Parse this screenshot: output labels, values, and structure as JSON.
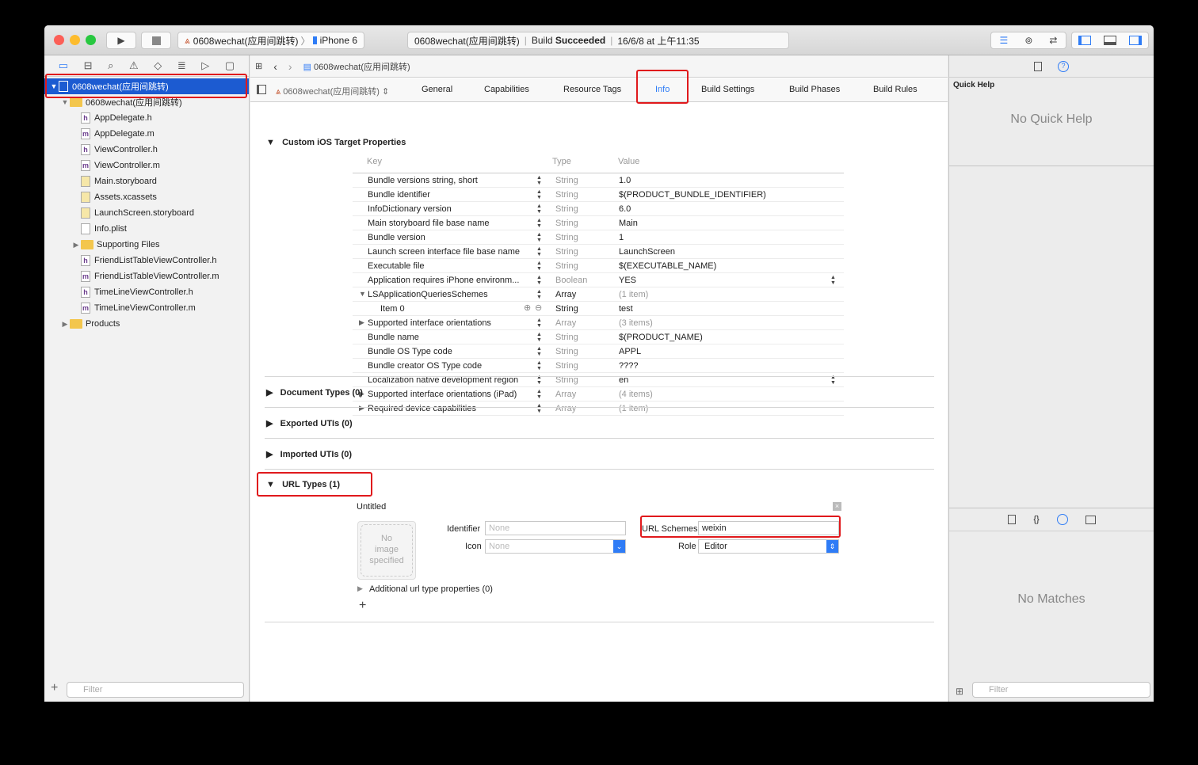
{
  "toolbar": {
    "scheme": "0608wechat(应用间跳转)",
    "device": "iPhone 6",
    "status_project": "0608wechat(应用间跳转)",
    "status_prefix": "Build ",
    "status_result": "Succeeded",
    "status_time": "16/6/8 at 上午11:35",
    "run_icon": "play-icon",
    "stop_icon": "stop-icon"
  },
  "navigator": {
    "icons": [
      "folder-icon",
      "hierarchy-icon",
      "search-icon",
      "warning-icon",
      "test-icon",
      "debug-icon",
      "breakpoint-icon",
      "report-icon"
    ],
    "items": [
      {
        "label": "0608wechat(应用间跳转)",
        "type": "project",
        "indent": 0,
        "disclosure": "open",
        "selected": true
      },
      {
        "label": "0608wechat(应用间跳转)",
        "type": "folder",
        "indent": 1,
        "disclosure": "open"
      },
      {
        "label": "AppDelegate.h",
        "type": "h",
        "indent": 2
      },
      {
        "label": "AppDelegate.m",
        "type": "m",
        "indent": 2
      },
      {
        "label": "ViewController.h",
        "type": "h",
        "indent": 2
      },
      {
        "label": "ViewController.m",
        "type": "m",
        "indent": 2
      },
      {
        "label": "Main.storyboard",
        "type": "storyboard",
        "indent": 2
      },
      {
        "label": "Assets.xcassets",
        "type": "assets",
        "indent": 2
      },
      {
        "label": "LaunchScreen.storyboard",
        "type": "storyboard",
        "indent": 2
      },
      {
        "label": "Info.plist",
        "type": "plist",
        "indent": 2
      },
      {
        "label": "Supporting Files",
        "type": "folder",
        "indent": 2,
        "disclosure": "closed"
      },
      {
        "label": "FriendListTableViewController.h",
        "type": "h",
        "indent": 2
      },
      {
        "label": "FriendListTableViewController.m",
        "type": "m",
        "indent": 2
      },
      {
        "label": "TimeLineViewController.h",
        "type": "h",
        "indent": 2
      },
      {
        "label": "TimeLineViewController.m",
        "type": "m",
        "indent": 2
      },
      {
        "label": "Products",
        "type": "folder",
        "indent": 1,
        "disclosure": "closed"
      }
    ],
    "filter_placeholder": "Filter",
    "add_label": "+"
  },
  "editor": {
    "breadcrumb": "0608wechat(应用间跳转)",
    "target": "0608wechat(应用间跳转)",
    "tabs": [
      "General",
      "Capabilities",
      "Resource Tags",
      "Info",
      "Build Settings",
      "Build Phases",
      "Build Rules"
    ],
    "active_tab": "Info",
    "custom_title": "Custom iOS Target Properties",
    "columns": {
      "key": "Key",
      "type": "Type",
      "value": "Value"
    },
    "properties": [
      {
        "key": "Bundle versions string, short",
        "type": "String",
        "value": "1.0"
      },
      {
        "key": "Bundle identifier",
        "type": "String",
        "value": "$(PRODUCT_BUNDLE_IDENTIFIER)"
      },
      {
        "key": "InfoDictionary version",
        "type": "String",
        "value": "6.0"
      },
      {
        "key": "Main storyboard file base name",
        "type": "String",
        "value": "Main"
      },
      {
        "key": "Bundle version",
        "type": "String",
        "value": "1"
      },
      {
        "key": "Launch screen interface file base name",
        "type": "String",
        "value": "LaunchScreen"
      },
      {
        "key": "Executable file",
        "type": "String",
        "value": "$(EXECUTABLE_NAME)"
      },
      {
        "key": "Application requires iPhone environm...",
        "type": "Boolean",
        "value": "YES",
        "popup": true
      },
      {
        "key": "LSApplicationQueriesSchemes",
        "type": "Array",
        "value": "(1 item)",
        "disclosure": "open",
        "dark_type": true
      },
      {
        "key": "Item 0",
        "type": "String",
        "value": "test",
        "child": true,
        "dark_type": true,
        "plusminus": true
      },
      {
        "key": "Supported interface orientations",
        "type": "Array",
        "value": "(3 items)",
        "disclosure": "closed"
      },
      {
        "key": "Bundle name",
        "type": "String",
        "value": "$(PRODUCT_NAME)"
      },
      {
        "key": "Bundle OS Type code",
        "type": "String",
        "value": "APPL"
      },
      {
        "key": "Bundle creator OS Type code",
        "type": "String",
        "value": "????"
      },
      {
        "key": "Localization native development region",
        "type": "String",
        "value": "en",
        "popup": true
      },
      {
        "key": "Supported interface orientations (iPad)",
        "type": "Array",
        "value": "(4 items)",
        "disclosure": "closed"
      },
      {
        "key": "Required device capabilities",
        "type": "Array",
        "value": "(1 item)",
        "disclosure": "closed"
      }
    ],
    "document_types": "Document Types (0)",
    "exported_utis": "Exported UTIs (0)",
    "imported_utis": "Imported UTIs (0)",
    "url_types": "URL Types (1)",
    "url_type": {
      "name": "Untitled",
      "no_image": [
        "No",
        "image",
        "specified"
      ],
      "identifier_label": "Identifier",
      "identifier_placeholder": "None",
      "icon_label": "Icon",
      "icon_placeholder": "None",
      "schemes_label": "URL Schemes",
      "schemes_value": "weixin",
      "role_label": "Role",
      "role_value": "Editor",
      "additional": "Additional url type properties (0)",
      "add": "+"
    }
  },
  "inspector": {
    "quick_help_title": "Quick Help",
    "no_quick_help": "No Quick Help",
    "no_matches": "No Matches",
    "filter_placeholder": "Filter"
  },
  "colors": {
    "selection": "#1c5bd1",
    "annotation": "#e0191c",
    "accent": "#2f7cf6"
  }
}
